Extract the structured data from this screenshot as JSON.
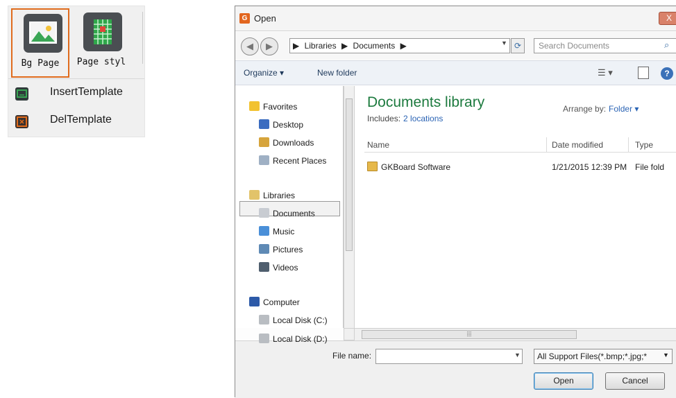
{
  "toolbar": {
    "buttons": [
      {
        "label": "Bg Page",
        "icon": "image-icon"
      },
      {
        "label": "Page styl",
        "icon": "grid-page-icon"
      }
    ],
    "menu": [
      {
        "label": "InsertTemplate",
        "icon": "insert-template-icon",
        "color": "#3aa655"
      },
      {
        "label": "DelTemplate",
        "icon": "delete-template-icon",
        "color": "#e06b1c"
      }
    ]
  },
  "dialog": {
    "app_icon_glyph": "G",
    "title": "Open",
    "close_glyph": "X",
    "back_glyph": "◀",
    "forward_glyph": "▶",
    "breadcrumb": [
      "Libraries",
      "Documents"
    ],
    "breadcrumb_sep": "▶",
    "search_placeholder": "Search Documents",
    "toolbar": {
      "organize": "Organize ▾",
      "new_folder": "New folder",
      "views_glyph": "☰ ▾",
      "help_glyph": "?"
    },
    "nav": {
      "favorites_header": "Favorites",
      "favorites": [
        "Desktop",
        "Downloads",
        "Recent Places"
      ],
      "libraries_header": "Libraries",
      "libraries": [
        "Documents",
        "Music",
        "Pictures",
        "Videos"
      ],
      "selected": "Documents",
      "computer_header": "Computer",
      "drives": [
        "Local Disk (C:)",
        "Local Disk (D:)"
      ]
    },
    "content": {
      "library_title": "Documents library",
      "includes_label": "Includes:",
      "includes_link": "2 locations",
      "arrange_label": "Arrange by:",
      "arrange_value": "Folder ▾",
      "columns": [
        "Name",
        "Date modified",
        "Type"
      ],
      "rows": [
        {
          "name": "GKBoard Software",
          "date": "1/21/2015 12:39 PM",
          "type": "File fold"
        }
      ]
    },
    "footer": {
      "file_name_label": "File name:",
      "file_name_value": "",
      "filter": "All Support Files(*.bmp;*.jpg;*",
      "open_label": "Open",
      "cancel_label": "Cancel"
    }
  }
}
